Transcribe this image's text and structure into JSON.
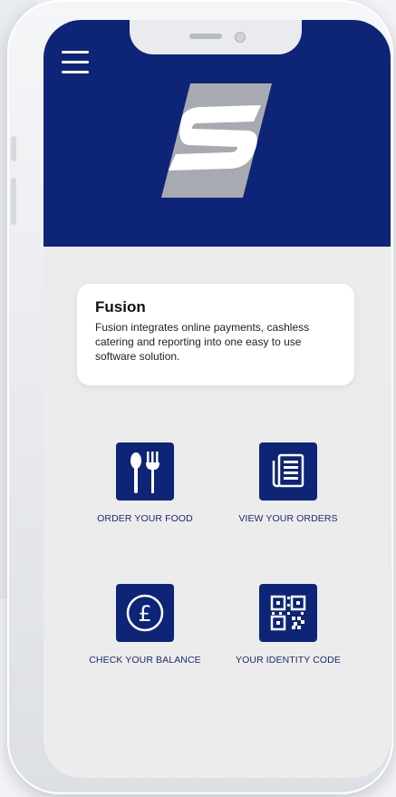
{
  "app": {
    "menu_icon": "hamburger-menu-icon",
    "logo_icon": "fusion-logo-icon"
  },
  "info_card": {
    "title": "Fusion",
    "description": "Fusion integrates online payments, cashless catering and reporting into one easy to use software solution."
  },
  "actions": [
    {
      "label": "ORDER YOUR FOOD",
      "icon": "cutlery-icon"
    },
    {
      "label": "VIEW YOUR ORDERS",
      "icon": "document-list-icon"
    },
    {
      "label": "CHECK YOUR BALANCE",
      "icon": "pound-coin-icon"
    },
    {
      "label": "YOUR IDENTITY CODE",
      "icon": "qr-code-icon"
    }
  ],
  "colors": {
    "brand_navy": "#0d2477",
    "screen_bg": "#ececec",
    "card_bg": "#ffffff",
    "label_text": "#1d2b6b"
  }
}
